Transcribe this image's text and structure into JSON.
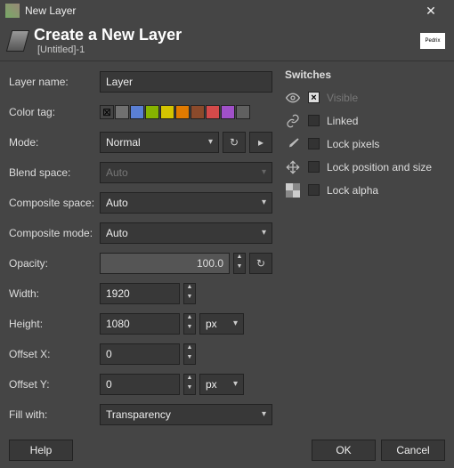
{
  "window": {
    "title": "New Layer"
  },
  "header": {
    "title": "Create a New Layer",
    "subtitle": "[Untitled]-1",
    "logo_text": "Pedrix"
  },
  "labels": {
    "layer_name": "Layer name:",
    "color_tag": "Color tag:",
    "mode": "Mode:",
    "blend_space": "Blend space:",
    "composite_space": "Composite space:",
    "composite_mode": "Composite mode:",
    "opacity": "Opacity:",
    "width": "Width:",
    "height": "Height:",
    "offset_x": "Offset X:",
    "offset_y": "Offset Y:",
    "fill_with": "Fill with:"
  },
  "values": {
    "layer_name": "Layer",
    "mode": "Normal",
    "blend_space": "Auto",
    "composite_space": "Auto",
    "composite_mode": "Auto",
    "opacity": "100.0",
    "width": "1920",
    "height": "1080",
    "offset_x": "0",
    "offset_y": "0",
    "unit": "px",
    "fill_with": "Transparency"
  },
  "color_tags": [
    "#707070",
    "#5a7fd4",
    "#86b300",
    "#d4c400",
    "#e07a00",
    "#8b4a2b",
    "#d44a4a",
    "#a050c8",
    "#606060"
  ],
  "switches": {
    "heading": "Switches",
    "visible": "Visible",
    "linked": "Linked",
    "lock_pixels": "Lock pixels",
    "lock_position": "Lock position and size",
    "lock_alpha": "Lock alpha",
    "visible_checked": true
  },
  "buttons": {
    "help": "Help",
    "ok": "OK",
    "cancel": "Cancel"
  }
}
